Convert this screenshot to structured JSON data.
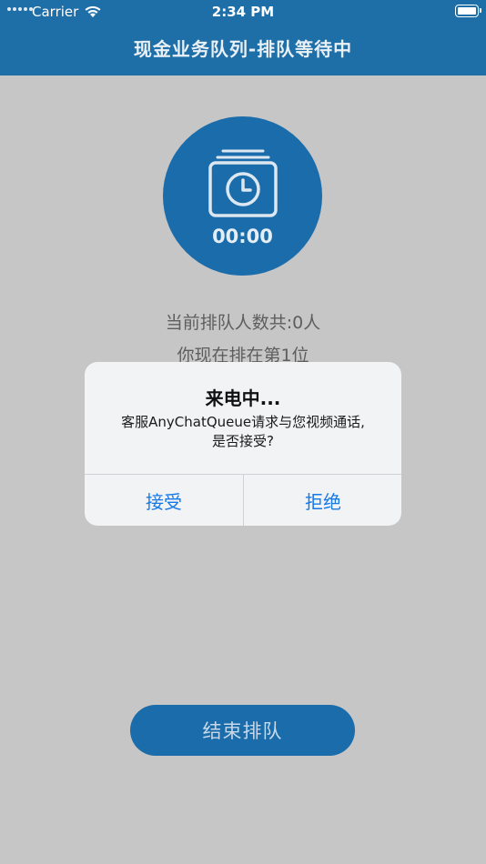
{
  "status_bar": {
    "carrier": "Carrier",
    "time": "2:34 PM"
  },
  "nav": {
    "title": "现金业务队列-排队等待中"
  },
  "timer": {
    "elapsed": "00:00",
    "icon": "clock-stack-icon"
  },
  "queue": {
    "total_line": "当前排队人数共:0人",
    "position_line": "你现在排在第1位"
  },
  "alert": {
    "title": "来电中...",
    "message_line1": "客服AnyChatQueue请求与您视频通话,",
    "message_line2": "是否接受?",
    "accept_label": "接受",
    "reject_label": "拒绝"
  },
  "actions": {
    "end_queue_label": "结束排队"
  },
  "colors": {
    "nav_bg": "#1e6ea8",
    "primary": "#1a6cab",
    "alert_button_text": "#1779e6",
    "background": "#c6c6c6"
  }
}
